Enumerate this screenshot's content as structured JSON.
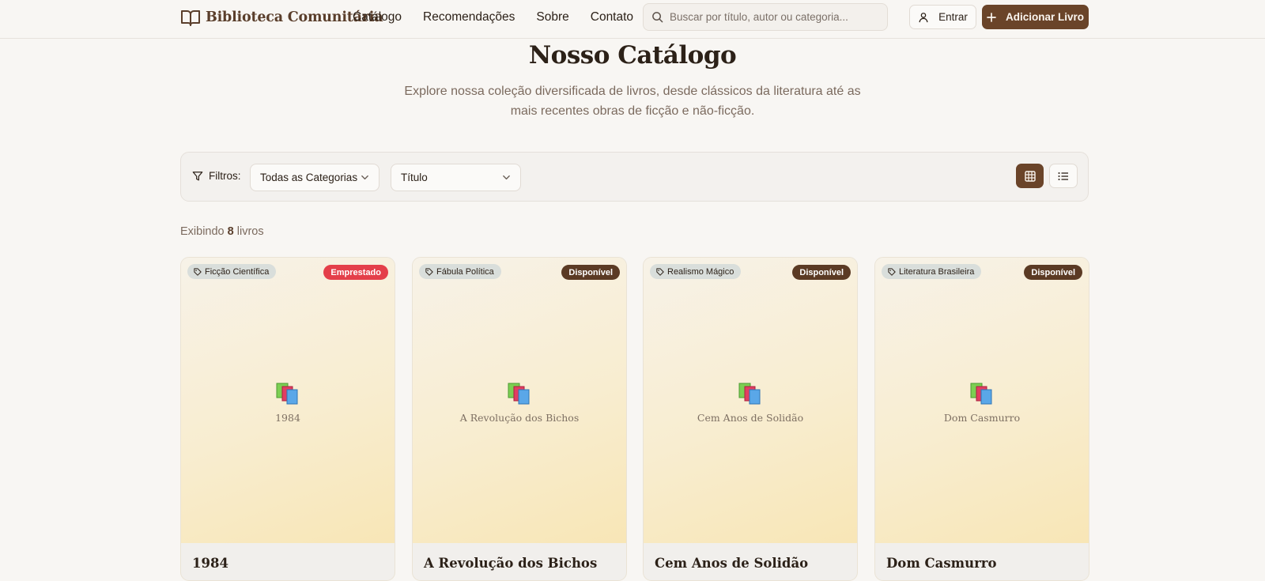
{
  "header": {
    "brand": "Biblioteca Comunitária",
    "nav": [
      "Catálogo",
      "Recomendações",
      "Sobre",
      "Contato"
    ],
    "search_placeholder": "Buscar por título, autor ou categoria...",
    "login_label": "Entrar",
    "add_label": "Adicionar Livro"
  },
  "hero": {
    "title": "Nosso Catálogo",
    "subtitle": "Explore nossa coleção diversificada de livros, desde clássicos da literatura até as mais recentes obras de ficção e não-ficção."
  },
  "filters": {
    "label": "Filtros:",
    "category_value": "Todas as Categorias",
    "sort_value": "Título",
    "view_mode": "grid"
  },
  "results": {
    "prefix": "Exibindo",
    "count": "8",
    "suffix": "livros"
  },
  "books": [
    {
      "title": "1984",
      "category": "Ficção Científica",
      "status": "Emprestado"
    },
    {
      "title": "A Revolução dos Bichos",
      "category": "Fábula Política",
      "status": "Disponível"
    },
    {
      "title": "Cem Anos de Solidão",
      "category": "Realismo Mágico",
      "status": "Disponível"
    },
    {
      "title": "Dom Casmurro",
      "category": "Literatura Brasileira",
      "status": "Disponível"
    }
  ],
  "colors": {
    "brand_brown": "#6a4429",
    "status_loaned": "#e43f4a",
    "status_available": "#5b3a24",
    "background": "#f8f6f3"
  },
  "icons": {
    "brand": "open-book-icon",
    "search": "search-icon",
    "login": "user-icon",
    "add": "plus-icon",
    "filter": "funnel-icon",
    "dropdown": "chevron-down-icon",
    "grid_view": "grid-icon",
    "list_view": "list-icon",
    "tag": "tag-icon",
    "cover": "books-emoji-icon"
  }
}
